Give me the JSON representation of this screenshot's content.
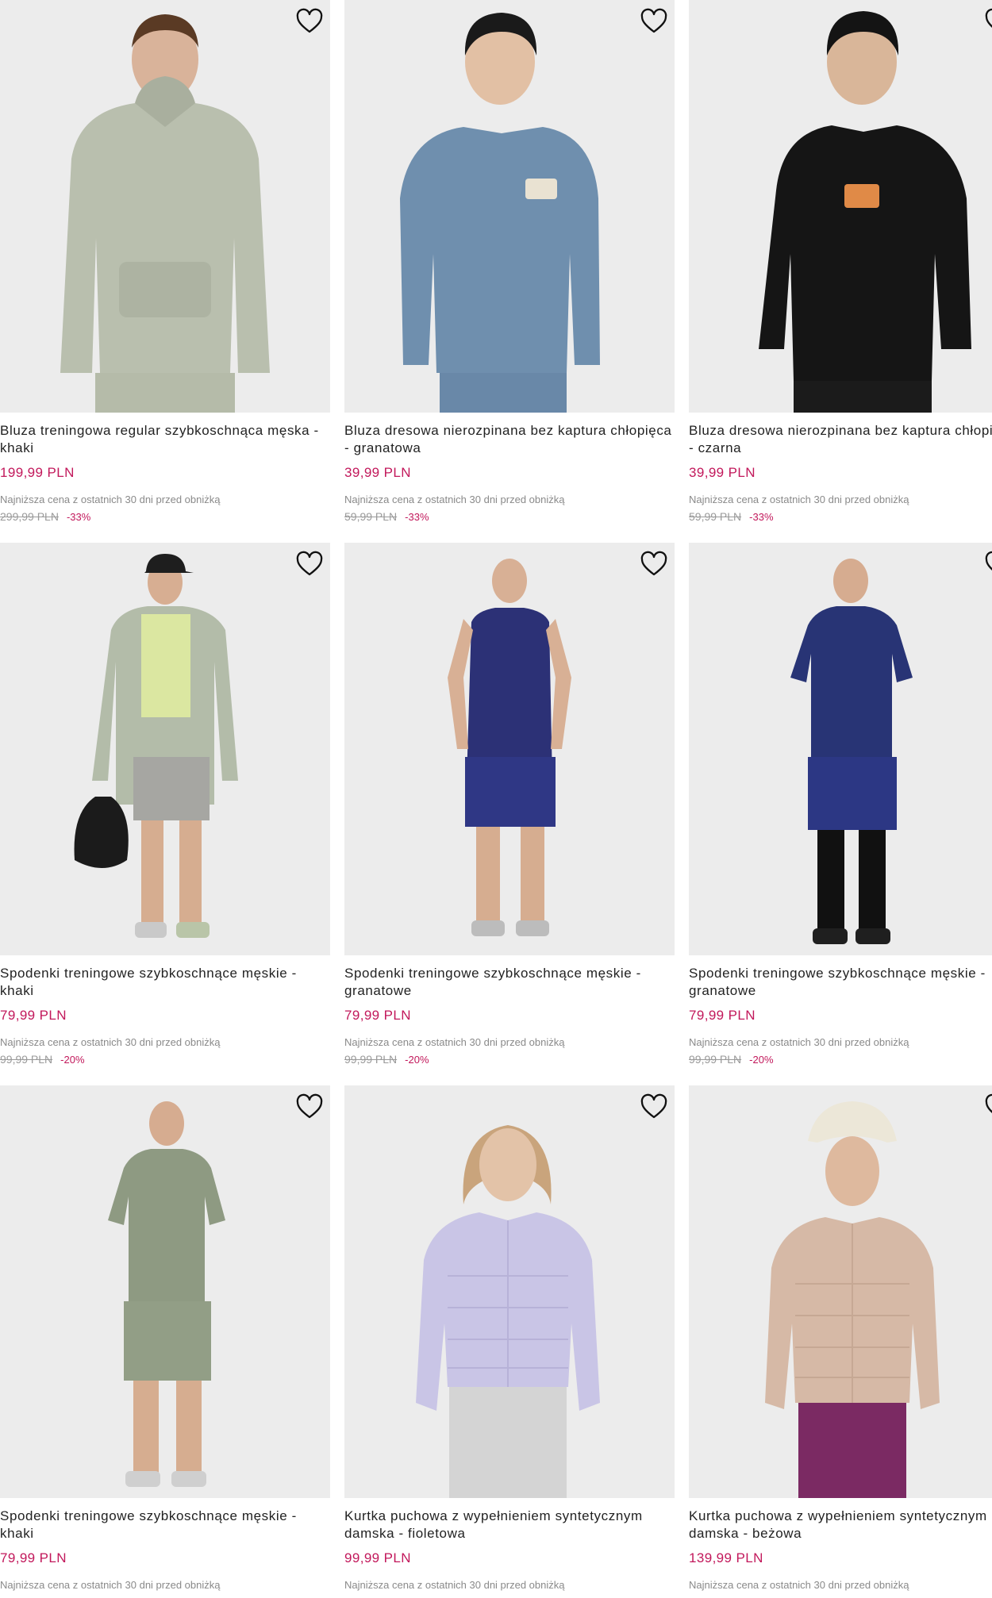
{
  "products": [
    {
      "name": "Bluza treningowa regular szybkoschnąca męska - khaki",
      "price": "199,99 PLN",
      "lowest_label": "Najniższa cena z ostatnich 30 dni przed obniżką",
      "old_price": "299,99 PLN",
      "discount": "-33%",
      "garment": "hoodie",
      "color": "#b9bfae",
      "icon": "heart-outline-icon"
    },
    {
      "name": "Bluza dresowa nierozpinana bez kaptura chłopięca - granatowa",
      "price": "39,99 PLN",
      "lowest_label": "Najniższa cena z ostatnich 30 dni przed obniżką",
      "old_price": "59,99 PLN",
      "discount": "-33%",
      "garment": "sweatshirt",
      "color": "#6f8fae",
      "icon": "heart-outline-icon"
    },
    {
      "name": "Bluza dresowa nierozpinana bez kaptura chłopięca - czarna",
      "price": "39,99 PLN",
      "lowest_label": "Najniższa cena z ostatnich 30 dni przed obniżką",
      "old_price": "59,99 PLN",
      "discount": "-33%",
      "garment": "sweatshirt",
      "color": "#151515",
      "icon": "heart-outline-icon"
    },
    {
      "name": "Spodenki treningowe szybkoschnące męskie - khaki",
      "price": "79,99 PLN",
      "lowest_label": "Najniższa cena z ostatnich 30 dni przed obniżką",
      "old_price": "99,99 PLN",
      "discount": "-20%",
      "garment": "jacket-shorts",
      "color": "#b3bca9",
      "icon": "heart-outline-icon"
    },
    {
      "name": "Spodenki treningowe szybkoschnące męskie - granatowe",
      "price": "79,99 PLN",
      "lowest_label": "Najniższa cena z ostatnich 30 dni przed obniżką",
      "old_price": "99,99 PLN",
      "discount": "-20%",
      "garment": "tank-shorts",
      "color": "#2c3176",
      "icon": "heart-outline-icon"
    },
    {
      "name": "Spodenki treningowe szybkoschnące męskie - granatowe",
      "price": "79,99 PLN",
      "lowest_label": "Najniższa cena z ostatnich 30 dni przed obniżką",
      "old_price": "99,99 PLN",
      "discount": "-20%",
      "garment": "tee-shorts",
      "color": "#283475",
      "icon": "heart-outline-icon"
    },
    {
      "name": "Spodenki treningowe szybkoschnące męskie - khaki",
      "price": "79,99 PLN",
      "lowest_label": "Najniższa cena z ostatnich 30 dni przed obniżką",
      "old_price": "",
      "discount": "",
      "garment": "tee-shorts",
      "color": "#8e9a82",
      "icon": "heart-outline-icon"
    },
    {
      "name": "Kurtka puchowa z wypełnieniem syntetycznym damska - fioletowa",
      "price": "99,99 PLN",
      "lowest_label": "Najniższa cena z ostatnich 30 dni przed obniżką",
      "old_price": "",
      "discount": "",
      "garment": "puffer",
      "color": "#c9c5e6",
      "icon": "heart-outline-icon"
    },
    {
      "name": "Kurtka puchowa z wypełnieniem syntetycznym damska - beżowa",
      "price": "139,99 PLN",
      "lowest_label": "Najniższa cena z ostatnich 30 dni przed obniżką",
      "old_price": "",
      "discount": "",
      "garment": "puffer",
      "color": "#d6b9a6",
      "icon": "heart-outline-icon"
    }
  ]
}
